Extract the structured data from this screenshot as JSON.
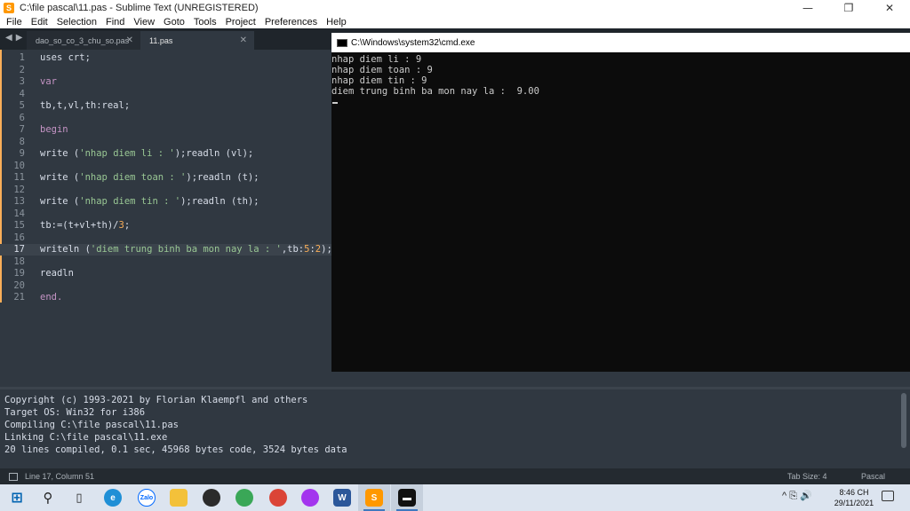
{
  "window": {
    "title": "C:\\file pascal\\11.pas - Sublime Text (UNREGISTERED)",
    "minimize": "—",
    "maximize": "❐",
    "close": "✕"
  },
  "menu": [
    "File",
    "Edit",
    "Selection",
    "Find",
    "View",
    "Goto",
    "Tools",
    "Project",
    "Preferences",
    "Help"
  ],
  "tabs": [
    {
      "label": "dao_so_co_3_chu_so.pas",
      "close": "✕"
    },
    {
      "label": "11.pas",
      "close": "✕"
    }
  ],
  "tab_nav": {
    "prev": "◀",
    "next": "▶"
  },
  "code_lines": [
    {
      "n": "1",
      "parts": [
        {
          "t": "uses crt;",
          "c": "fn"
        }
      ]
    },
    {
      "n": "2",
      "parts": []
    },
    {
      "n": "3",
      "parts": [
        {
          "t": "var",
          "c": "kw"
        }
      ]
    },
    {
      "n": "4",
      "parts": []
    },
    {
      "n": "5",
      "parts": [
        {
          "t": "tb,t,vl,th:real;",
          "c": "fn"
        }
      ]
    },
    {
      "n": "6",
      "parts": []
    },
    {
      "n": "7",
      "parts": [
        {
          "t": "begin",
          "c": "kw"
        }
      ]
    },
    {
      "n": "8",
      "parts": []
    },
    {
      "n": "9",
      "parts": [
        {
          "t": "write (",
          "c": "fn"
        },
        {
          "t": "'nhap diem li : '",
          "c": "str"
        },
        {
          "t": ");readln (vl);",
          "c": "fn"
        }
      ]
    },
    {
      "n": "10",
      "parts": []
    },
    {
      "n": "11",
      "parts": [
        {
          "t": "write (",
          "c": "fn"
        },
        {
          "t": "'nhap diem toan : '",
          "c": "str"
        },
        {
          "t": ");readln (t);",
          "c": "fn"
        }
      ]
    },
    {
      "n": "12",
      "parts": []
    },
    {
      "n": "13",
      "parts": [
        {
          "t": "write (",
          "c": "fn"
        },
        {
          "t": "'nhap diem tin : '",
          "c": "str"
        },
        {
          "t": ");readln (th);",
          "c": "fn"
        }
      ]
    },
    {
      "n": "14",
      "parts": []
    },
    {
      "n": "15",
      "parts": [
        {
          "t": "tb:=(t+vl+th)/",
          "c": "fn"
        },
        {
          "t": "3",
          "c": "num"
        },
        {
          "t": ";",
          "c": "fn"
        }
      ]
    },
    {
      "n": "16",
      "parts": []
    },
    {
      "n": "17",
      "parts": [
        {
          "t": "writeln (",
          "c": "fn"
        },
        {
          "t": "'diem trung binh ba mon nay la : '",
          "c": "str"
        },
        {
          "t": ",tb:",
          "c": "fn"
        },
        {
          "t": "5",
          "c": "num"
        },
        {
          "t": ":",
          "c": "fn"
        },
        {
          "t": "2",
          "c": "num"
        },
        {
          "t": ");",
          "c": "fn"
        }
      ],
      "active": true
    },
    {
      "n": "18",
      "parts": []
    },
    {
      "n": "19",
      "parts": [
        {
          "t": "readln",
          "c": "fn"
        }
      ]
    },
    {
      "n": "20",
      "parts": []
    },
    {
      "n": "21",
      "parts": [
        {
          "t": "end.",
          "c": "kw"
        }
      ]
    }
  ],
  "cmd": {
    "title": "C:\\Windows\\system32\\cmd.exe",
    "lines": [
      "nhap diem li : 9",
      "nhap diem toan : 9",
      "nhap diem tin : 9",
      "diem trung binh ba mon nay la :  9.00"
    ]
  },
  "output": {
    "lines": [
      "Copyright (c) 1993-2021 by Florian Klaempfl and others",
      "Target OS: Win32 for i386",
      "Compiling C:\\file pascal\\11.pas",
      "Linking C:\\file pascal\\11.exe",
      "20 lines compiled, 0.1 sec, 45968 bytes code, 3524 bytes data"
    ]
  },
  "status": {
    "position": "Line 17, Column 51",
    "tab_size": "Tab Size: 4",
    "syntax": "Pascal"
  },
  "taskbar": {
    "time": "8:46 CH",
    "date": "29/11/2021",
    "tray_icons": "^ ⎘ 🔊"
  },
  "colors": {
    "editor_bg": "#303841",
    "accent": "#f9ae58",
    "string": "#99c794",
    "keyword": "#c594c5"
  }
}
